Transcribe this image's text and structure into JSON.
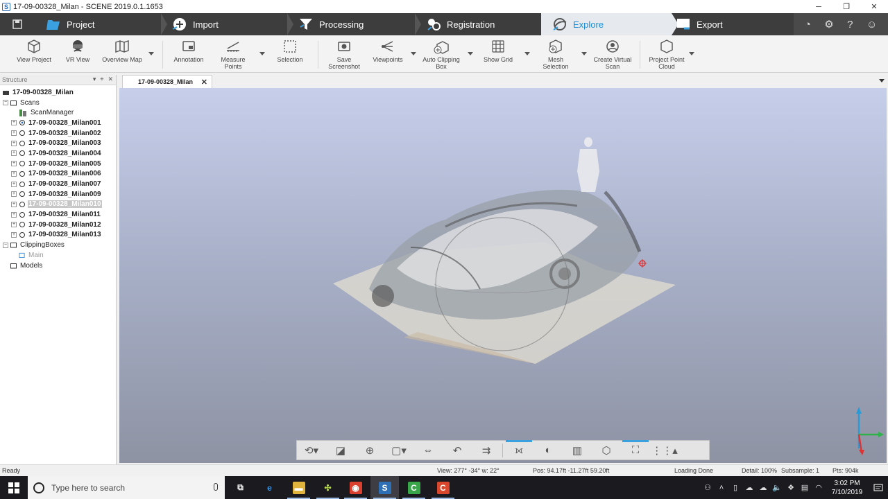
{
  "window": {
    "title": "17-09-00328_Milan - SCENE 2019.0.1.1653",
    "controls": [
      "─",
      "❐",
      "✕"
    ]
  },
  "workflow": {
    "steps": [
      {
        "label": "Project"
      },
      {
        "label": "Import"
      },
      {
        "label": "Processing"
      },
      {
        "label": "Registration"
      },
      {
        "label": "Explore",
        "active": true
      },
      {
        "label": "Export"
      }
    ]
  },
  "ribbon": {
    "buttons": [
      {
        "label": "View Project",
        "icon": "cube-icon"
      },
      {
        "label": "VR View",
        "icon": "vr-headset-icon"
      },
      {
        "label": "Overview Map",
        "icon": "map-icon"
      },
      {
        "label": "Annotation",
        "icon": "annotation-icon"
      },
      {
        "label": "Measure Points",
        "icon": "measure-icon"
      },
      {
        "label": "Selection",
        "icon": "selection-icon"
      },
      {
        "label": "Save Screenshot",
        "icon": "camera-icon"
      },
      {
        "label": "Viewpoints",
        "icon": "viewpoints-icon"
      },
      {
        "label": "Auto Clipping Box",
        "icon": "clipping-box-icon"
      },
      {
        "label": "Show Grid",
        "icon": "grid-icon"
      },
      {
        "label": "Mesh Selection",
        "icon": "mesh-icon"
      },
      {
        "label": "Create Virtual Scan",
        "icon": "virtual-scan-icon"
      },
      {
        "label": "Project Point Cloud",
        "icon": "point-cloud-icon"
      }
    ]
  },
  "structure": {
    "header": "Structure",
    "header_buttons": [
      "▾",
      "⌖",
      "✕"
    ],
    "tree": [
      {
        "label": "17-09-00328_Milan",
        "level": 0,
        "bold": true,
        "icon": "project-icon"
      },
      {
        "label": "Scans",
        "level": 1,
        "expander": "−",
        "icon": "scans-folder-icon"
      },
      {
        "label": "ScanManager",
        "level": 2,
        "icon": "scan-manager-icon"
      },
      {
        "label": "17-09-00328_Milan001",
        "level": 2,
        "bold": true,
        "expander": "+",
        "icon": "scan-reference-icon"
      },
      {
        "label": "17-09-00328_Milan002",
        "level": 2,
        "bold": true,
        "expander": "+",
        "icon": "scan-icon"
      },
      {
        "label": "17-09-00328_Milan003",
        "level": 2,
        "bold": true,
        "expander": "+",
        "icon": "scan-icon"
      },
      {
        "label": "17-09-00328_Milan004",
        "level": 2,
        "bold": true,
        "expander": "+",
        "icon": "scan-icon"
      },
      {
        "label": "17-09-00328_Milan005",
        "level": 2,
        "bold": true,
        "expander": "+",
        "icon": "scan-icon"
      },
      {
        "label": "17-09-00328_Milan006",
        "level": 2,
        "bold": true,
        "expander": "+",
        "icon": "scan-icon"
      },
      {
        "label": "17-09-00328_Milan007",
        "level": 2,
        "bold": true,
        "expander": "+",
        "icon": "scan-icon"
      },
      {
        "label": "17-09-00328_Milan009",
        "level": 2,
        "bold": true,
        "expander": "+",
        "icon": "scan-icon"
      },
      {
        "label": "17-09-00328_Milan010",
        "level": 2,
        "bold": true,
        "expander": "+",
        "icon": "scan-icon",
        "selected": true
      },
      {
        "label": "17-09-00328_Milan011",
        "level": 2,
        "bold": true,
        "expander": "+",
        "icon": "scan-icon"
      },
      {
        "label": "17-09-00328_Milan012",
        "level": 2,
        "bold": true,
        "expander": "+",
        "icon": "scan-icon"
      },
      {
        "label": "17-09-00328_Milan013",
        "level": 2,
        "bold": true,
        "expander": "+",
        "icon": "scan-icon"
      },
      {
        "label": "ClippingBoxes",
        "level": 1,
        "expander": "−",
        "icon": "folder-icon"
      },
      {
        "label": "Main",
        "level": 2,
        "dim": true,
        "icon": "clipping-box-icon"
      },
      {
        "label": "Models",
        "level": 1,
        "icon": "folder-icon"
      }
    ]
  },
  "doc_tab": {
    "label": "17-09-00328_Milan",
    "close": "✕"
  },
  "navbar": {
    "buttons": [
      {
        "icon": "orbit-icon",
        "glyph": "⟲▾"
      },
      {
        "icon": "perspective-icon",
        "glyph": "◪"
      },
      {
        "icon": "zoom-icon",
        "glyph": "⊕"
      },
      {
        "icon": "view-cube-icon",
        "glyph": "▢▾"
      },
      {
        "icon": "walk-icon",
        "glyph": "⇔"
      },
      {
        "icon": "undo-view-icon",
        "glyph": "↶"
      },
      {
        "icon": "reset-view-icon",
        "glyph": "⇉"
      },
      {
        "icon": "clip-plane-icon",
        "glyph": "⟗",
        "active": true
      },
      {
        "icon": "split-view-icon",
        "glyph": "◐"
      },
      {
        "icon": "slice-icon",
        "glyph": "▥"
      },
      {
        "icon": "box-icon",
        "glyph": "⬡"
      },
      {
        "icon": "fit-view-icon",
        "glyph": "⛶",
        "active": true
      },
      {
        "icon": "more-icon",
        "glyph": "⋮⋮▴"
      }
    ]
  },
  "status": {
    "ready": "Ready",
    "view": "View: 277° -34° w: 22°",
    "pos": "Pos: 94.17ft -11.27ft 59.20ft",
    "loading": "Loading Done",
    "detail": "Detail: 100%",
    "subsample": "Subsample:  1",
    "pts": "Pts: 904k"
  },
  "taskbar": {
    "search_placeholder": "Type here to search",
    "time": "3:02 PM",
    "date": "7/10/2019",
    "apps": [
      {
        "name": "task-view",
        "glyph": "⧉",
        "color": "#1b1b1f"
      },
      {
        "name": "edge",
        "glyph": "e",
        "color": "#1b1b1f"
      },
      {
        "name": "file-explorer",
        "glyph": "▬",
        "color": "#e0b33c"
      },
      {
        "name": "app-green",
        "glyph": "✣",
        "color": "#1b1b1f"
      },
      {
        "name": "chrome",
        "glyph": "◉",
        "color": "#d9402f"
      },
      {
        "name": "scene",
        "glyph": "S",
        "color": "#2e6fb5"
      },
      {
        "name": "camtasia",
        "glyph": "C",
        "color": "#3aa64a"
      },
      {
        "name": "recorder",
        "glyph": "C",
        "color": "#d9472c"
      }
    ]
  },
  "colors": {
    "workflow_bg": "#3d3d3d",
    "active_step": "#e6e9ee",
    "accent": "#1c8fd6",
    "viewport_top": "#c6ceea",
    "viewport_bottom": "#8e93a3"
  }
}
